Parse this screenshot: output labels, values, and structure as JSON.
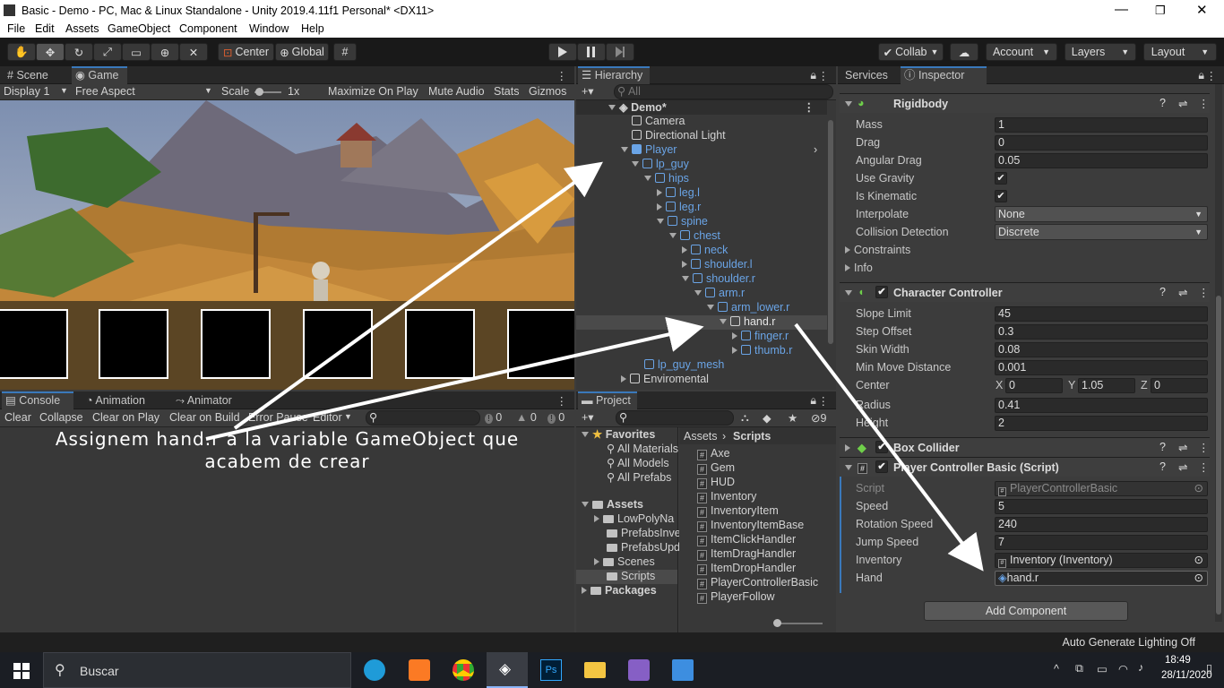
{
  "window": {
    "title": "Basic - Demo - PC, Mac & Linux Standalone - Unity 2019.4.11f1 Personal* <DX11>"
  },
  "menu": [
    "File",
    "Edit",
    "Assets",
    "GameObject",
    "Component",
    "Window",
    "Help"
  ],
  "toolbar": {
    "center": "Center",
    "global": "Global",
    "collab": "Collab",
    "account": "Account",
    "layers": "Layers",
    "layout": "Layout"
  },
  "game_panel": {
    "tabs": [
      "Scene",
      "Game"
    ],
    "display": "Display 1",
    "aspect": "Free Aspect",
    "scale_label": "Scale",
    "scale_value": "1x",
    "buttons": [
      "Maximize On Play",
      "Mute Audio",
      "Stats",
      "Gizmos"
    ]
  },
  "annotation": {
    "line1": "Assignem hand.r a la variable GameObject que",
    "line2": "acabem de crear"
  },
  "console": {
    "tabs": [
      "Console",
      "Animation",
      "Animator"
    ],
    "buttons": [
      "Clear",
      "Collapse",
      "Clear on Play",
      "Clear on Build",
      "Error Pause"
    ],
    "editor": "Editor",
    "counts": [
      "0",
      "0",
      "0"
    ]
  },
  "hierarchy": {
    "title": "Hierarchy",
    "search_placeholder": "All",
    "scene": "Demo*",
    "items": [
      "Camera",
      "Directional Light",
      "Player",
      "lp_guy",
      "hips",
      "leg.l",
      "leg.r",
      "spine",
      "chest",
      "neck",
      "shoulder.l",
      "shoulder.r",
      "arm.r",
      "arm_lower.r",
      "hand.r",
      "finger.r",
      "thumb.r",
      "lp_guy_mesh",
      "Enviromental"
    ]
  },
  "project": {
    "title": "Project",
    "hidden_count": "9",
    "favorites": {
      "title": "Favorites",
      "items": [
        "All Materials",
        "All Models",
        "All Prefabs"
      ]
    },
    "assets": {
      "title": "Assets",
      "items": [
        "LowPolyNa",
        "PrefabsInve",
        "PrefabsUpd",
        "Scenes",
        "Scripts"
      ]
    },
    "packages": "Packages",
    "breadcrumb": [
      "Assets",
      "Scripts"
    ],
    "scripts": [
      "Axe",
      "Gem",
      "HUD",
      "Inventory",
      "InventoryItem",
      "InventoryItemBase",
      "ItemClickHandler",
      "ItemDragHandler",
      "ItemDropHandler",
      "PlayerControllerBasic",
      "PlayerFollow"
    ]
  },
  "inspector": {
    "tabs": [
      "Services",
      "Inspector"
    ],
    "rigidbody": {
      "title": "Rigidbody",
      "fields": [
        {
          "label": "Mass",
          "value": "1"
        },
        {
          "label": "Drag",
          "value": "0"
        },
        {
          "label": "Angular Drag",
          "value": "0.05"
        }
      ],
      "use_gravity": "Use Gravity",
      "is_kinematic": "Is Kinematic",
      "interpolate": {
        "label": "Interpolate",
        "value": "None"
      },
      "collision": {
        "label": "Collision Detection",
        "value": "Discrete"
      },
      "constraints": "Constraints",
      "info": "Info"
    },
    "character_controller": {
      "title": "Character Controller",
      "fields": [
        {
          "label": "Slope Limit",
          "value": "45"
        },
        {
          "label": "Step Offset",
          "value": "0.3"
        },
        {
          "label": "Skin Width",
          "value": "0.08"
        },
        {
          "label": "Min Move Distance",
          "value": "0.001"
        }
      ],
      "center": {
        "label": "Center",
        "x": "0",
        "y": "1.05",
        "z": "0"
      },
      "radius": {
        "label": "Radius",
        "value": "0.41"
      },
      "height": {
        "label": "Height",
        "value": "2"
      }
    },
    "box_collider": {
      "title": "Box Collider"
    },
    "player_controller": {
      "title": "Player Controller Basic (Script)",
      "script": {
        "label": "Script",
        "value": "PlayerControllerBasic"
      },
      "fields": [
        {
          "label": "Speed",
          "value": "5"
        },
        {
          "label": "Rotation Speed",
          "value": "240"
        },
        {
          "label": "Jump Speed",
          "value": "7"
        }
      ],
      "inventory": {
        "label": "Inventory",
        "value": "Inventory (Inventory)"
      },
      "hand": {
        "label": "Hand",
        "value": "hand.r"
      }
    },
    "add_component": "Add Component"
  },
  "status": {
    "text": "Auto Generate Lighting Off"
  },
  "taskbar": {
    "search": "Buscar",
    "time": "18:49",
    "date": "28/11/2020"
  }
}
